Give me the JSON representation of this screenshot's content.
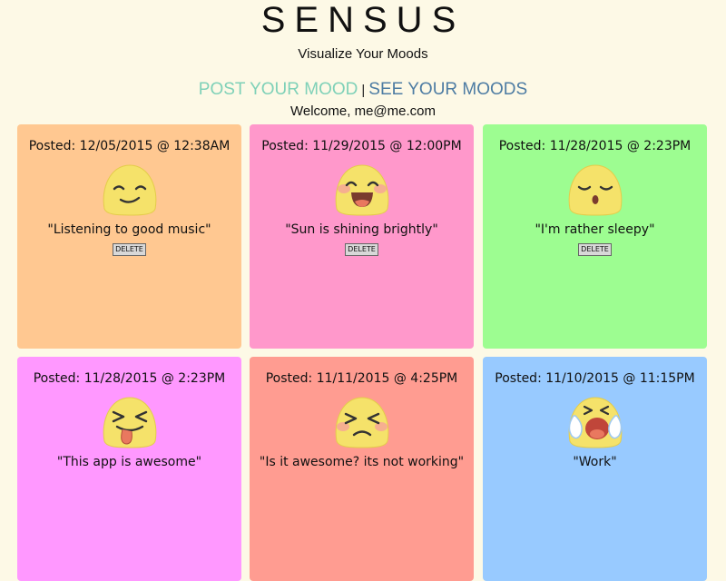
{
  "header": {
    "brand": "SENSUS",
    "tagline": "Visualize Your Moods"
  },
  "nav": {
    "post_label": "POST YOUR MOOD",
    "separator": "|",
    "see_label": "SEE YOUR MOODS",
    "post_color": "#7fd1b8",
    "see_color": "#4d7ca3"
  },
  "welcome": "Welcome, me@me.com",
  "moods": [
    {
      "posted": "Posted: 12/05/2015 @ 12:38AM",
      "note": "\"Listening to good music\"",
      "delete_label": "DELETE",
      "color": "#ffc891",
      "face": "smirk-face-icon"
    },
    {
      "posted": "Posted: 11/29/2015 @ 12:00PM",
      "note": "\"Sun is shining brightly\"",
      "delete_label": "DELETE",
      "color": "#ff98cb",
      "face": "laughing-face-icon"
    },
    {
      "posted": "Posted: 11/28/2015 @ 2:23PM",
      "note": "\"I'm rather sleepy\"",
      "delete_label": "DELETE",
      "color": "#9dfd91",
      "face": "sleepy-face-icon"
    },
    {
      "posted": "Posted: 11/28/2015 @ 2:23PM",
      "note": "\"This app is awesome\"",
      "color": "#ff98ff",
      "face": "tongue-face-icon"
    },
    {
      "posted": "Posted: 11/11/2015 @ 4:25PM",
      "note": "\"Is it awesome? its not working\"",
      "color": "#ff9c91",
      "face": "frustrated-face-icon"
    },
    {
      "posted": "Posted: 11/10/2015 @ 11:15PM",
      "note": "\"Work\"",
      "color": "#98caff",
      "face": "crying-face-icon"
    }
  ]
}
